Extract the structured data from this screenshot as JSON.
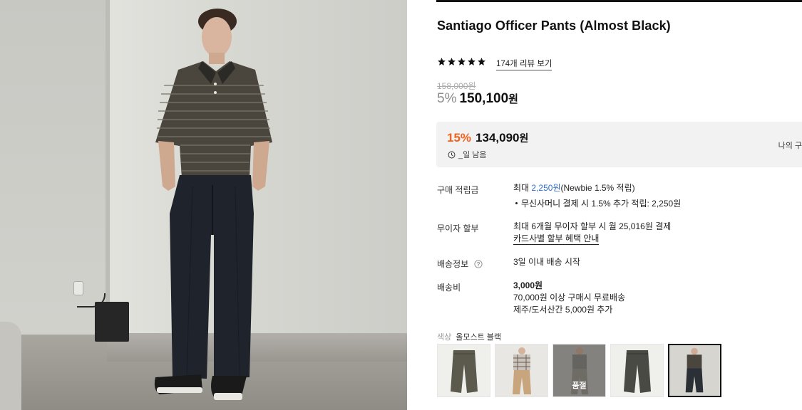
{
  "product": {
    "title": "Santiago Officer Pants (Almost Black)",
    "rating_stars": 5,
    "review_link": "174개 리뷰 보기",
    "original_price": "158,000원",
    "discount_pct": "5%",
    "sale_price": "150,100",
    "sale_price_unit": "원"
  },
  "coupon": {
    "pct": "15%",
    "price": "134,090",
    "price_unit": "원",
    "time_left": "_일 남음",
    "right_text": "나의 구"
  },
  "details": {
    "points_label": "구매 적립금",
    "points_prefix": "최대 ",
    "points_amount": "2,250원",
    "points_suffix": "(Newbie 1.5% 적립)",
    "points_bullet": "무신사머니 결제 시 1.5% 추가 적립: 2,250원",
    "installment_label": "무이자 할부",
    "installment_value": "최대 6개월 무이자 할부 시 월 25,016원 결제",
    "installment_link": "카드사별 할부 혜택 안내",
    "shipping_info_label": "배송정보",
    "shipping_info_value": "3일 이내 배송 시작",
    "shipping_fee_label": "배송비",
    "shipping_fee_value": "3,000원",
    "shipping_fee_free": "70,000원 이상 구매시 무료배송",
    "shipping_fee_jeju": "제주/도서산간 5,000원 추가"
  },
  "color": {
    "label": "색상",
    "selected_name": "올모스트 블랙",
    "options": [
      {
        "name": "olive-flat-pants",
        "sold_out": false,
        "selected": false,
        "tone": "#5b5a4d"
      },
      {
        "name": "beige-model",
        "sold_out": false,
        "selected": false,
        "tone": "#c8a57c"
      },
      {
        "name": "grey-model",
        "sold_out": true,
        "selected": false,
        "tone": "#9a968e"
      },
      {
        "name": "charcoal-flat-pants",
        "sold_out": false,
        "selected": false,
        "tone": "#4a4a44"
      },
      {
        "name": "black-model",
        "sold_out": false,
        "selected": true,
        "tone": "#2b2f36"
      }
    ],
    "sold_out_label": "품절"
  },
  "colors": {
    "accent_orange": "#f2611d",
    "link_blue": "#2f6fd0",
    "coupon_bg": "#f2f2f2"
  }
}
